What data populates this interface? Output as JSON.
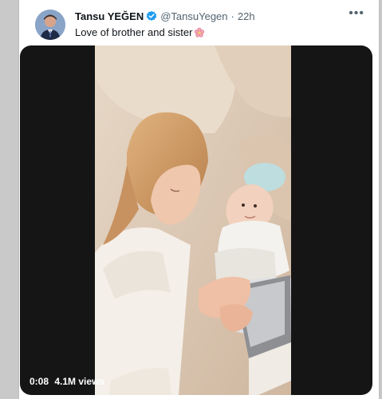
{
  "tweet": {
    "display_name": "Tansu YEĞEN",
    "handle": "@TansuYegen",
    "separator": "·",
    "time": "22h",
    "text": "Love of brother and sister",
    "emoji": "flower-emoji",
    "more_icon": "ellipsis-icon",
    "verified_icon": "verified-badge-icon"
  },
  "media": {
    "duration": "0:08",
    "views": "4.1M views"
  },
  "colors": {
    "verified": "#1d9bf0",
    "text": "#0f1419",
    "secondary": "#536471",
    "media_bg": "#151515"
  }
}
